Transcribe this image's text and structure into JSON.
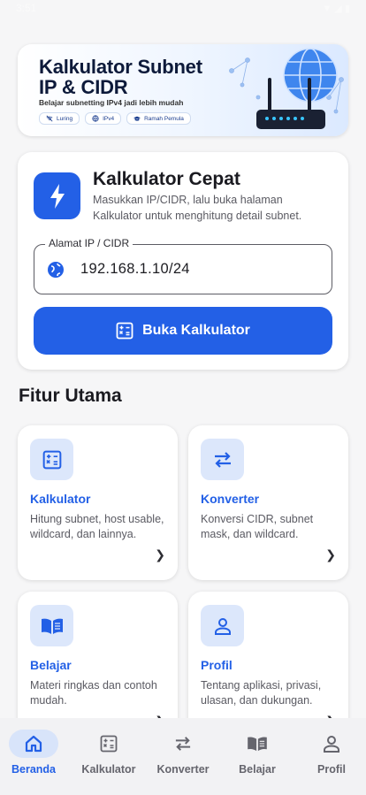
{
  "status": {
    "time": "3:51",
    "icons": "▼ ◢ ▮"
  },
  "banner": {
    "title": "Kalkulator Subnet IP & CIDR",
    "subtitle": "Belajar subnetting IPv4 jadi lebih mudah",
    "chips": [
      "Luring",
      "IPv4",
      "Ramah Pemula"
    ]
  },
  "quick": {
    "title": "Kalkulator Cepat",
    "description": "Masukkan IP/CIDR, lalu buka halaman Kalkulator untuk menghitung detail subnet.",
    "field_label": "Alamat IP / CIDR",
    "field_value": "192.168.1.10/24",
    "button_label": "Buka Kalkulator"
  },
  "section_title": "Fitur Utama",
  "features": [
    {
      "title": "Kalkulator",
      "description": "Hitung subnet, host usable, wildcard, dan lainnya.",
      "icon": "calculator-icon"
    },
    {
      "title": "Konverter",
      "description": "Konversi CIDR, subnet mask, dan wildcard.",
      "icon": "swap-icon"
    },
    {
      "title": "Belajar",
      "description": "Materi ringkas dan contoh mudah.",
      "icon": "book-icon"
    },
    {
      "title": "Profil",
      "description": "Tentang aplikasi, privasi, ulasan, dan dukungan.",
      "icon": "person-icon"
    }
  ],
  "nav": [
    {
      "label": "Beranda",
      "icon": "home-icon",
      "active": true
    },
    {
      "label": "Kalkulator",
      "icon": "calculator-icon"
    },
    {
      "label": "Konverter",
      "icon": "swap-icon"
    },
    {
      "label": "Belajar",
      "icon": "book-icon"
    },
    {
      "label": "Profil",
      "icon": "person-icon"
    }
  ],
  "colors": {
    "accent": "#2360e6",
    "accent_soft": "#dce7fb",
    "background": "#f6f6f7"
  }
}
